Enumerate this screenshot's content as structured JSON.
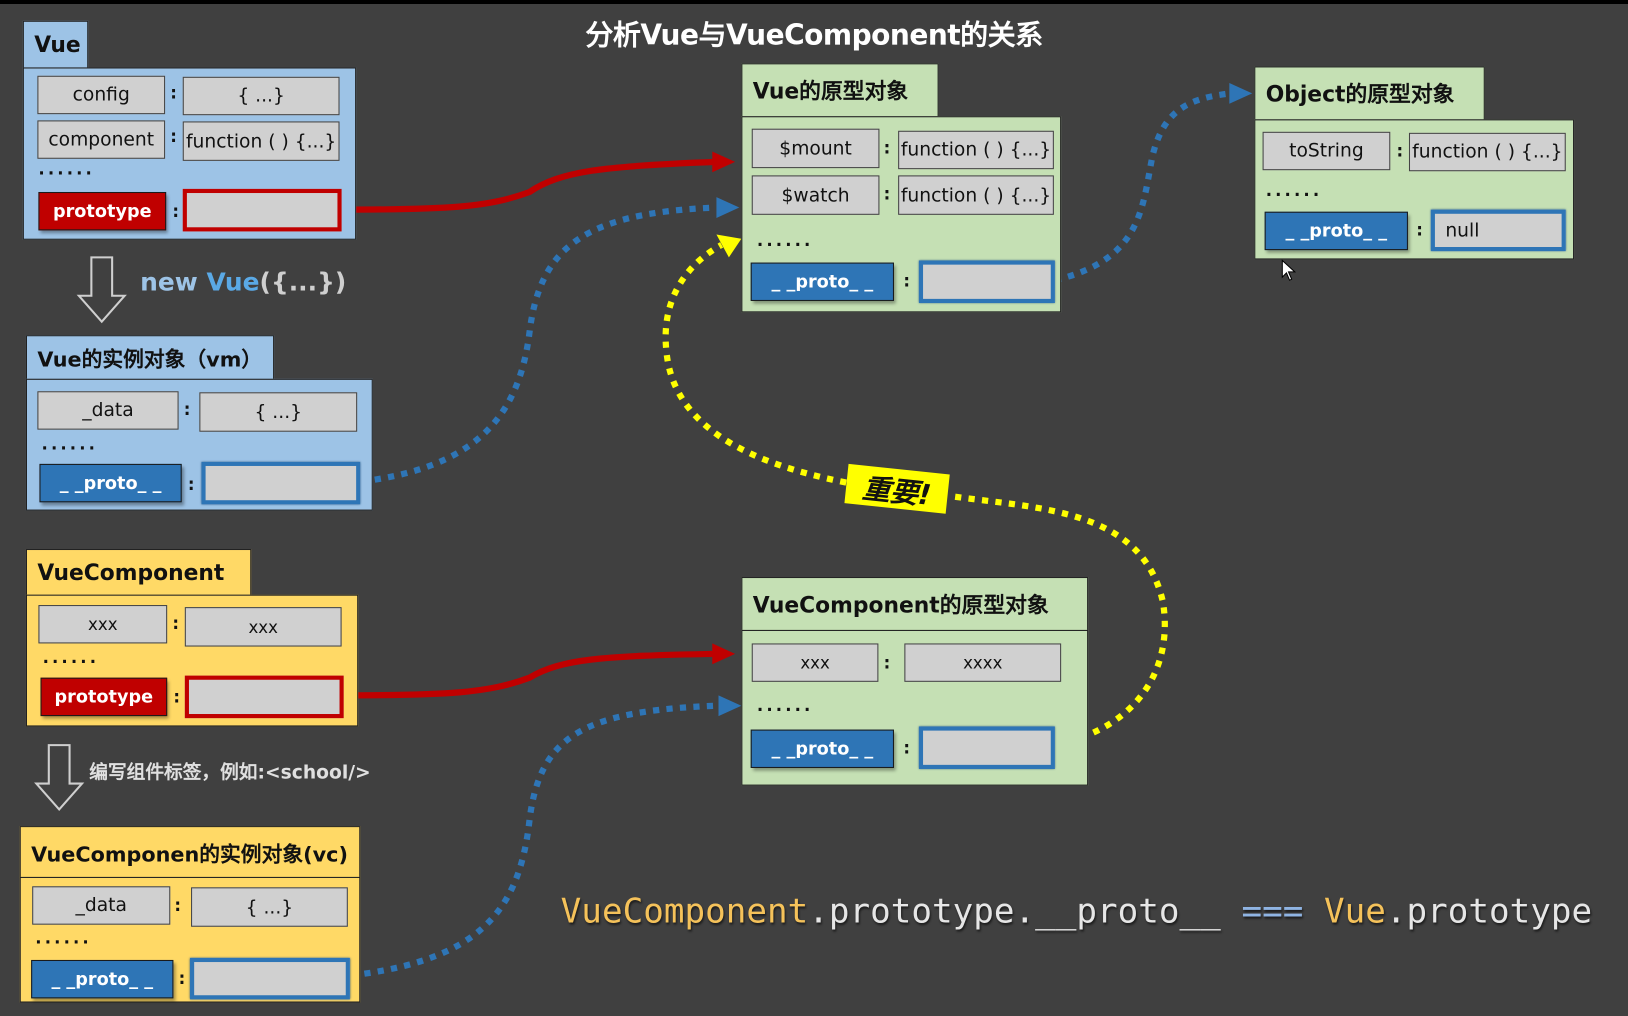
{
  "title": "分析Vue与VueComponent的关系",
  "colors": {
    "background": "#404040",
    "vue_box": "#9dc3e6",
    "component_box": "#ffd966",
    "prototype_box": "#c5e0b4",
    "prototype_link": "#c00000",
    "proto_link": "#2e75b6",
    "important_link": "#ffff00",
    "formula_class": "#f5c25a",
    "formula_text": "#e6e6e6",
    "formula_op": "#8fb4e3"
  },
  "vue": {
    "header": "Vue",
    "rows": [
      {
        "key": "config",
        "value": "{ ...}"
      },
      {
        "key": "component",
        "value": "function ( ) {...}"
      }
    ],
    "ellipsis": "......",
    "prototype_key": "prototype",
    "colon": ":"
  },
  "new_vue_label": {
    "prefix": "new ",
    "name": "Vue",
    "suffix": "({...})"
  },
  "vm": {
    "header": "Vue的实例对象（vm）",
    "rows": [
      {
        "key": "_data",
        "value": "{ ...}"
      }
    ],
    "ellipsis": "......",
    "proto_key": "_ _proto_ _",
    "colon": ":"
  },
  "vue_component": {
    "header": "VueComponent",
    "rows": [
      {
        "key": "xxx",
        "value": "xxx"
      }
    ],
    "ellipsis": "......",
    "prototype_key": "prototype",
    "colon": ":"
  },
  "write_tag_label": "编写组件标签，例如:<school/>",
  "vc": {
    "header": "VueComponen的实例对象(vc)",
    "rows": [
      {
        "key": "_data",
        "value": "{ ...}"
      }
    ],
    "ellipsis": "......",
    "proto_key": "_ _proto_ _",
    "colon": ":"
  },
  "vue_prototype": {
    "header": "Vue的原型对象",
    "rows": [
      {
        "key": "$mount",
        "value": "function ( ) {...}"
      },
      {
        "key": "$watch",
        "value": "function ( ) {...}"
      }
    ],
    "ellipsis": "......",
    "proto_key": "_ _proto_ _",
    "colon": ":"
  },
  "object_prototype": {
    "header": "Object的原型对象",
    "rows": [
      {
        "key": "toString",
        "value": "function ( ) {...}"
      }
    ],
    "ellipsis": "......",
    "proto_key": "_ _proto_ _",
    "proto_value": "null",
    "colon": ":"
  },
  "vc_prototype": {
    "header": "VueComponent的原型对象",
    "rows": [
      {
        "key": "xxx",
        "value": "xxxx"
      }
    ],
    "ellipsis": "......",
    "proto_key": "_ _proto_ _",
    "colon": ":"
  },
  "important_label": "重要!",
  "formula": {
    "part1": "VueComponent",
    "part2": ".prototype.__proto__ ",
    "op": "===",
    "part3": " Vue",
    "part4": ".prototype"
  },
  "icons": [
    "down-arrow-icon",
    "mouse-cursor-icon"
  ]
}
